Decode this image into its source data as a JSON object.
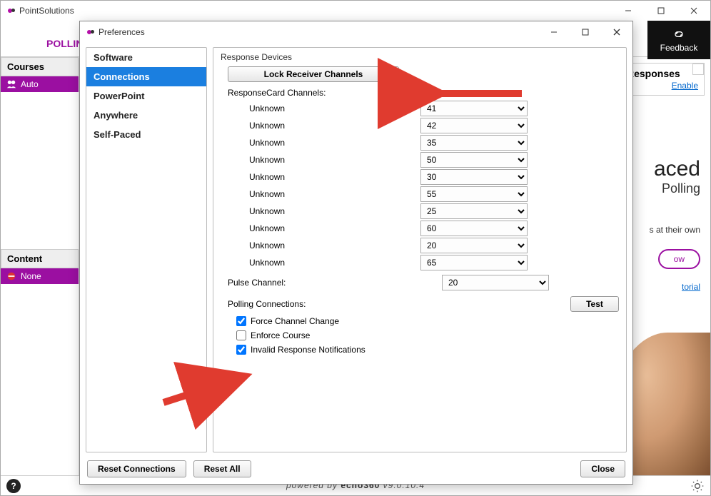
{
  "main": {
    "title": "PointSolutions",
    "tab_polling": "POLLING",
    "feedback": "Feedback"
  },
  "sidebar": {
    "courses_header": "Courses",
    "course_item": "Auto",
    "content_header": "Content",
    "content_item": "None"
  },
  "responses": {
    "header": "Responses",
    "enable": "Enable"
  },
  "card": {
    "big": "aced",
    "sub": "Polling",
    "para": "s at their own",
    "btn": "ow",
    "tutorial": "torial"
  },
  "footer": {
    "powered_left": "powered by ",
    "powered_brand": "echo360",
    "version": " v9.0.10.4"
  },
  "pref": {
    "title": "Preferences",
    "nav": [
      "Software",
      "Connections",
      "PowerPoint",
      "Anywhere",
      "Self-Paced"
    ],
    "nav_selected_index": 1,
    "group_title": "Response Devices",
    "lock_btn": "Lock Receiver Channels",
    "responsecard_label": "ResponseCard Channels:",
    "channel_rows": [
      {
        "label": "Unknown",
        "value": "41"
      },
      {
        "label": "Unknown",
        "value": "42"
      },
      {
        "label": "Unknown",
        "value": "35"
      },
      {
        "label": "Unknown",
        "value": "50"
      },
      {
        "label": "Unknown",
        "value": "30"
      },
      {
        "label": "Unknown",
        "value": "55"
      },
      {
        "label": "Unknown",
        "value": "25"
      },
      {
        "label": "Unknown",
        "value": "60"
      },
      {
        "label": "Unknown",
        "value": "20"
      },
      {
        "label": "Unknown",
        "value": "65"
      }
    ],
    "pulse_label": "Pulse Channel:",
    "pulse_value": "20",
    "polling_label": "Polling Connections:",
    "test_btn": "Test",
    "chk_force": "Force Channel Change",
    "chk_enforce": "Enforce Course",
    "chk_invalid": "Invalid Response Notifications",
    "chk_force_checked": true,
    "chk_enforce_checked": false,
    "chk_invalid_checked": true,
    "reset_connections": "Reset Connections",
    "reset_all": "Reset All",
    "close": "Close"
  }
}
